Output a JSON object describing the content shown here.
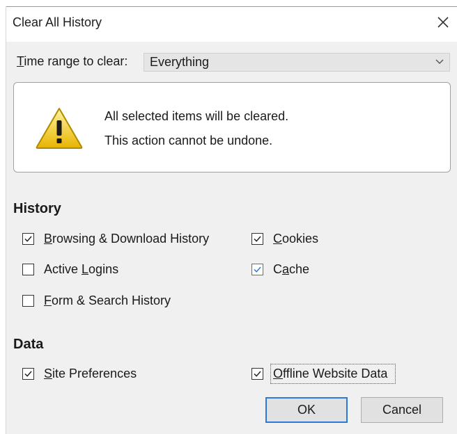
{
  "window": {
    "title": "Clear All History",
    "close_icon": "close-icon"
  },
  "time_range": {
    "label_accel": "T",
    "label_rest": "ime range to clear:",
    "selected": "Everything"
  },
  "warning": {
    "icon": "warning-icon",
    "line1": "All selected items will be cleared.",
    "line2": "This action cannot be undone."
  },
  "history": {
    "heading": "History",
    "items": [
      {
        "pre": "",
        "accel": "B",
        "post": "rowsing & Download History",
        "checked": true
      },
      {
        "pre": "",
        "accel": "C",
        "post": "ookies",
        "checked": true
      },
      {
        "pre": "Active ",
        "accel": "L",
        "post": "ogins",
        "checked": false
      },
      {
        "pre": "C",
        "accel": "a",
        "post": "che",
        "checked": true
      },
      {
        "pre": "",
        "accel": "F",
        "post": "orm & Search History",
        "checked": false
      }
    ]
  },
  "data": {
    "heading": "Data",
    "items": [
      {
        "pre": "",
        "accel": "S",
        "post": "ite Preferences",
        "checked": true
      },
      {
        "pre": "",
        "accel": "O",
        "post": "ffline Website Data",
        "checked": true
      }
    ]
  },
  "buttons": {
    "ok": "OK",
    "cancel": "Cancel"
  },
  "colors": {
    "accent": "#2a7ad8",
    "dialog_bg": "#f0f0f0"
  }
}
